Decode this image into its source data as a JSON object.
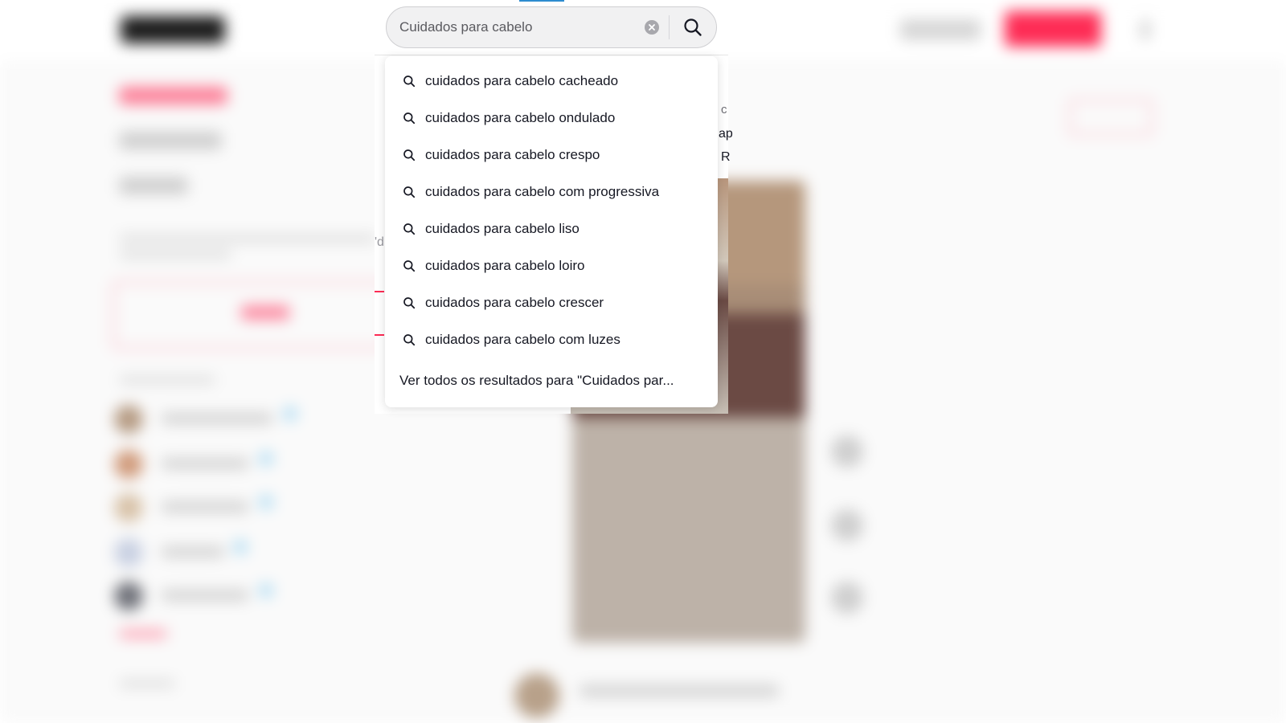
{
  "search": {
    "value": "Cuidados para cabelo",
    "placeholder": ""
  },
  "icons": {
    "clear": "clear-circle-icon",
    "search": "search-icon",
    "suggestion": "search-icon"
  },
  "suggestions": [
    {
      "label": "cuidados para cabelo cacheado"
    },
    {
      "label": "cuidados para cabelo ondulado"
    },
    {
      "label": "cuidados para cabelo crespo"
    },
    {
      "label": "cuidados para cabelo com progressiva"
    },
    {
      "label": "cuidados para cabelo liso"
    },
    {
      "label": "cuidados para cabelo loiro"
    },
    {
      "label": "cuidados para cabelo crescer"
    },
    {
      "label": "cuidados para cabelo com luzes"
    }
  ],
  "see_all": "Ver todos os resultados para \"Cuidados par...",
  "edge_fragments": {
    "c": "c",
    "ap": "ap",
    "r": "R",
    "d": "'d"
  },
  "colors": {
    "brand": "#fe2c55",
    "text": "#161823",
    "search_bg": "#f1f1f2"
  }
}
